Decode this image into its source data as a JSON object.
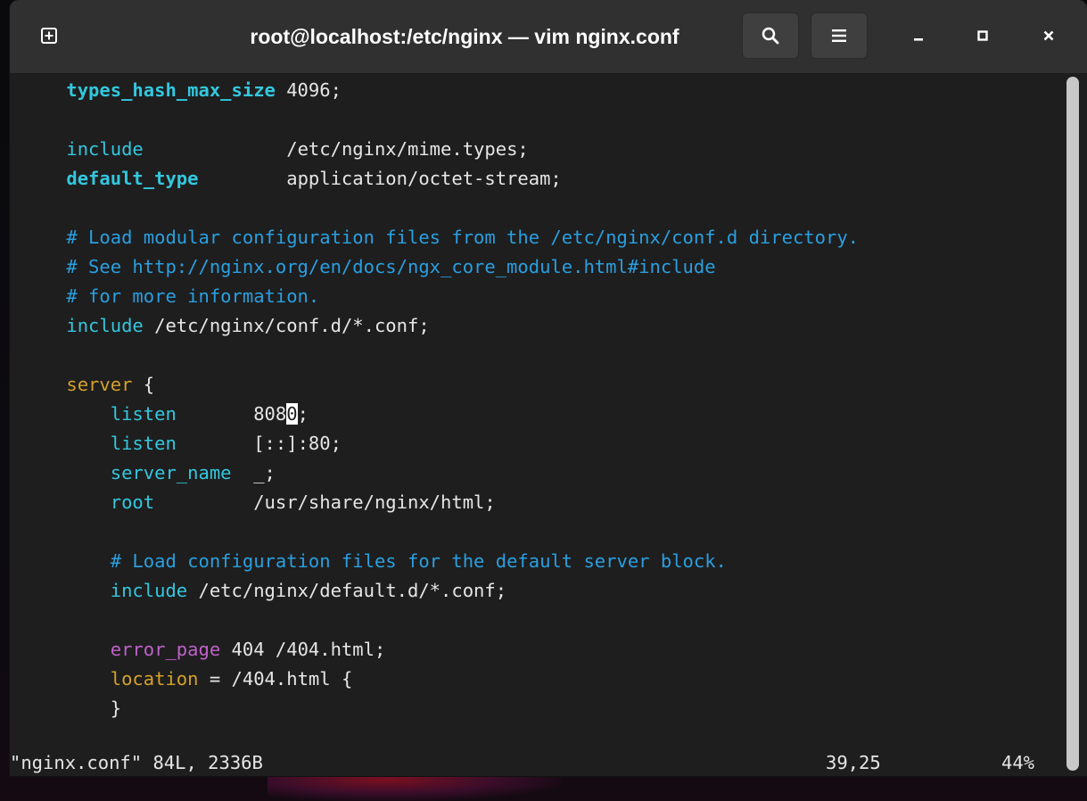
{
  "window": {
    "title": "root@localhost:/etc/nginx — vim nginx.conf"
  },
  "headerbar": {
    "buttons": [
      {
        "name": "new-tab",
        "icon": "new-tab-icon"
      },
      {
        "name": "search",
        "icon": "search-icon"
      },
      {
        "name": "menu",
        "icon": "hamburger-menu-icon"
      },
      {
        "name": "minimize",
        "icon": "minimize-icon"
      },
      {
        "name": "maximize",
        "icon": "maximize-icon"
      },
      {
        "name": "close",
        "icon": "close-icon"
      }
    ]
  },
  "editor": {
    "lines": [
      {
        "indent": "    ",
        "parts": [
          {
            "t": "types_hash_max_size",
            "c": "kw-bold"
          },
          {
            "t": " 4096;",
            "c": ""
          }
        ]
      },
      {
        "indent": "",
        "parts": []
      },
      {
        "indent": "    ",
        "parts": [
          {
            "t": "include",
            "c": "kw"
          },
          {
            "t": "             /etc/nginx/mime.types;",
            "c": ""
          }
        ]
      },
      {
        "indent": "    ",
        "parts": [
          {
            "t": "default_type",
            "c": "kw-bold"
          },
          {
            "t": "        application/octet-stream;",
            "c": ""
          }
        ]
      },
      {
        "indent": "",
        "parts": []
      },
      {
        "indent": "    ",
        "parts": [
          {
            "t": "# Load modular configuration files from the /etc/nginx/conf.d directory.",
            "c": "comment"
          }
        ]
      },
      {
        "indent": "    ",
        "parts": [
          {
            "t": "# See http://nginx.org/en/docs/ngx_core_module.html#include",
            "c": "comment"
          }
        ]
      },
      {
        "indent": "    ",
        "parts": [
          {
            "t": "# for more information.",
            "c": "comment"
          }
        ]
      },
      {
        "indent": "    ",
        "parts": [
          {
            "t": "include",
            "c": "kw"
          },
          {
            "t": " /etc/nginx/conf.d/*.conf;",
            "c": ""
          }
        ]
      },
      {
        "indent": "",
        "parts": []
      },
      {
        "indent": "    ",
        "parts": [
          {
            "t": "server",
            "c": "yellow"
          },
          {
            "t": " {",
            "c": ""
          }
        ]
      },
      {
        "indent": "        ",
        "parts": [
          {
            "t": "listen",
            "c": "kw"
          },
          {
            "t": "       808",
            "c": ""
          },
          {
            "t": "0",
            "c": "cursor"
          },
          {
            "t": ";",
            "c": ""
          }
        ]
      },
      {
        "indent": "        ",
        "parts": [
          {
            "t": "listen",
            "c": "kw"
          },
          {
            "t": "       [::]:80;",
            "c": ""
          }
        ]
      },
      {
        "indent": "        ",
        "parts": [
          {
            "t": "server_name",
            "c": "kw"
          },
          {
            "t": "  _;",
            "c": ""
          }
        ]
      },
      {
        "indent": "        ",
        "parts": [
          {
            "t": "root",
            "c": "kw"
          },
          {
            "t": "         /usr/share/nginx/html;",
            "c": ""
          }
        ]
      },
      {
        "indent": "",
        "parts": []
      },
      {
        "indent": "        ",
        "parts": [
          {
            "t": "# Load configuration files for the default server block.",
            "c": "comment"
          }
        ]
      },
      {
        "indent": "        ",
        "parts": [
          {
            "t": "include",
            "c": "kw"
          },
          {
            "t": " /etc/nginx/default.d/*.conf;",
            "c": ""
          }
        ]
      },
      {
        "indent": "",
        "parts": []
      },
      {
        "indent": "        ",
        "parts": [
          {
            "t": "error_page",
            "c": "purple"
          },
          {
            "t": " 404 /404.html;",
            "c": ""
          }
        ]
      },
      {
        "indent": "        ",
        "parts": [
          {
            "t": "location",
            "c": "yellow"
          },
          {
            "t": " = /404.html {",
            "c": ""
          }
        ]
      },
      {
        "indent": "        ",
        "parts": [
          {
            "t": "}",
            "c": ""
          }
        ]
      }
    ]
  },
  "statusline": {
    "file_info": "\"nginx.conf\" 84L, 2336B",
    "position": "39,25",
    "percent": "44%"
  },
  "colors": {
    "background": "#1e1e1e",
    "headerbar": "#303030",
    "keyword": "#33c7de",
    "comment": "#2a9fe0",
    "block": "#d4a12a",
    "directive_special": "#c061cb"
  }
}
